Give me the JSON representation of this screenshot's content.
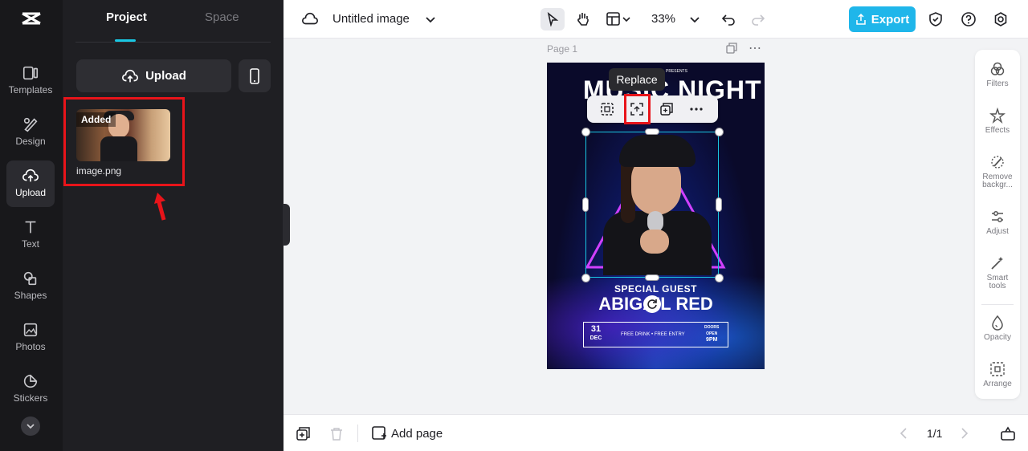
{
  "rail": {
    "items": [
      {
        "label": "Templates",
        "icon": "templates-icon"
      },
      {
        "label": "Design",
        "icon": "design-icon"
      },
      {
        "label": "Upload",
        "icon": "upload-cloud-icon",
        "active": true
      },
      {
        "label": "Text",
        "icon": "text-icon"
      },
      {
        "label": "Shapes",
        "icon": "shapes-icon"
      },
      {
        "label": "Photos",
        "icon": "photos-icon"
      },
      {
        "label": "Stickers",
        "icon": "stickers-icon"
      }
    ]
  },
  "panel": {
    "tabs": [
      "Project",
      "Space"
    ],
    "upload_label": "Upload",
    "asset": {
      "badge": "Added",
      "name": "image.png"
    }
  },
  "topbar": {
    "title": "Untitled image",
    "zoom": "33%",
    "export_label": "Export"
  },
  "canvas": {
    "page_label": "Page 1",
    "tooltip": "Replace"
  },
  "poster": {
    "presents": "PRESENTS",
    "headline": "MUSIC NIGHT",
    "special": "SPECIAL GUEST",
    "guest": "ABIGAIL RED",
    "date_day": "31",
    "date_month": "DEC",
    "free": "FREE DRINK • FREE ENTRY",
    "doors_1": "DOORS",
    "doors_2": "OPEN",
    "doors_3": "9PM"
  },
  "right_panel": {
    "items": [
      "Filters",
      "Effects",
      "Remove backgr...",
      "Adjust",
      "Smart tools",
      "Opacity",
      "Arrange"
    ]
  },
  "bottombar": {
    "add_page": "Add page",
    "page_count": "1/1"
  },
  "colors": {
    "accent": "#19c7e3",
    "export": "#1fb6ea",
    "highlight": "#e8141a"
  }
}
